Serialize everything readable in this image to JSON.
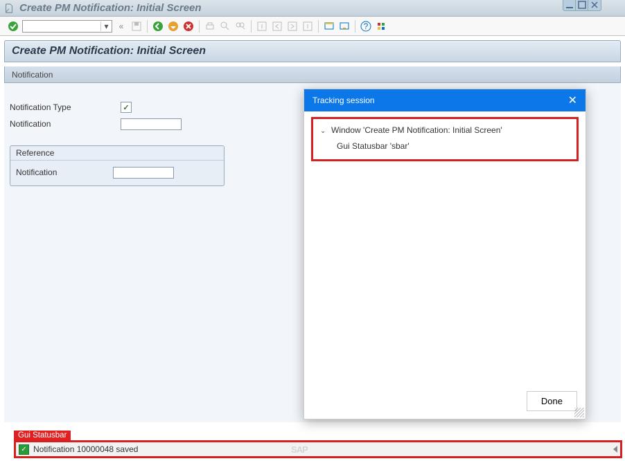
{
  "window": {
    "title": "Create PM Notification: Initial Screen"
  },
  "header": {
    "title": "Create PM Notification: Initial Screen",
    "subheader": "Notification"
  },
  "form": {
    "notificationType_label": "Notification Type",
    "notification_label": "Notification",
    "notification_value": ""
  },
  "groupbox": {
    "reference_title": "Reference",
    "ref_notification_label": "Notification",
    "ref_notification_value": ""
  },
  "tracking": {
    "title": "Tracking session",
    "tree_node1": "Window 'Create PM Notification: Initial Screen'",
    "tree_node2": "Gui Statusbar 'sbar'",
    "done_label": "Done"
  },
  "statusbar": {
    "tag": "Gui Statusbar",
    "message": "Notification 10000048 saved",
    "logo": "SAP"
  }
}
